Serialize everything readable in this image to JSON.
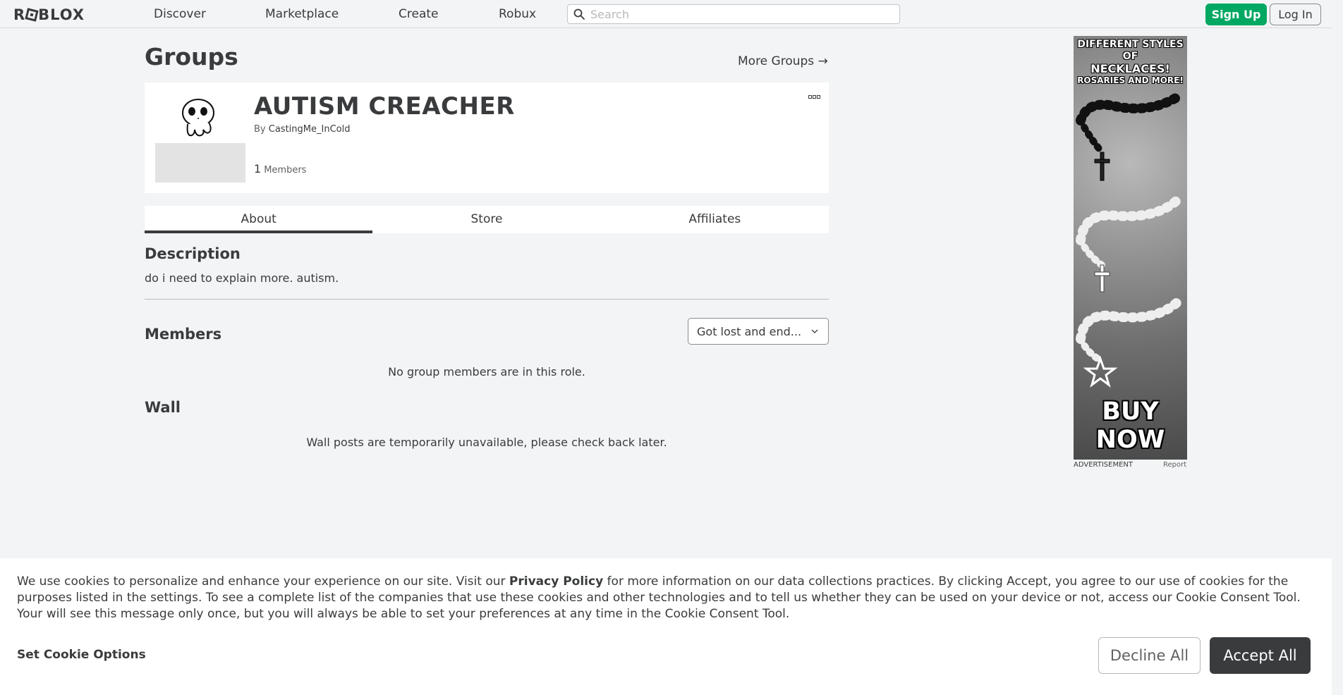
{
  "header": {
    "logo": "ROBLOX",
    "nav": [
      "Discover",
      "Marketplace",
      "Create",
      "Robux"
    ],
    "search_placeholder": "Search",
    "signup_label": "Sign Up",
    "login_label": "Log In",
    "search_icon": "search-icon"
  },
  "page": {
    "title": "Groups",
    "more_groups": "More Groups →"
  },
  "group": {
    "name": "AUTISM CREACHER",
    "by_label": "By",
    "owner": "CastingMe_InCold",
    "member_count": "1",
    "members_label": "Members"
  },
  "tabs": [
    "About",
    "Store",
    "Affiliates"
  ],
  "about": {
    "description_heading": "Description",
    "description": "do i need to explain more. autism.",
    "members_heading": "Members",
    "role_selected": "Got lost and end...",
    "members_empty": "No group members are in this role.",
    "wall_heading": "Wall",
    "wall_empty": "Wall posts are temporarily unavailable, please check back later."
  },
  "ad": {
    "headline_line1": "DIFFERENT STYLES OF",
    "headline_line2": "NECKLACES!",
    "headline_line3": "ROSARIES AND MORE!",
    "cta": "BUY NOW",
    "label": "ADVERTISEMENT",
    "report": "Report"
  },
  "cookies": {
    "text_before": "We use cookies to personalize and enhance your experience on our site. Visit our ",
    "privacy_link": "Privacy Policy",
    "text_after": " for more information on our data collections practices. By clicking Accept, you agree to our use of cookies for the purposes listed in the settings. To see a complete list of the companies that use these cookies and other technologies and to tell us whether they can be used on your device or not, access our Cookie Consent Tool. Your will see this message only once, but you will always be able to set your preferences at any time in the Cookie Consent Tool.",
    "set_options": "Set Cookie Options",
    "decline": "Decline All",
    "accept": "Accept All"
  },
  "colors": {
    "signup_green": "#00a862",
    "accept_dark": "#393b3d",
    "page_bg": "#f2f4f5"
  }
}
